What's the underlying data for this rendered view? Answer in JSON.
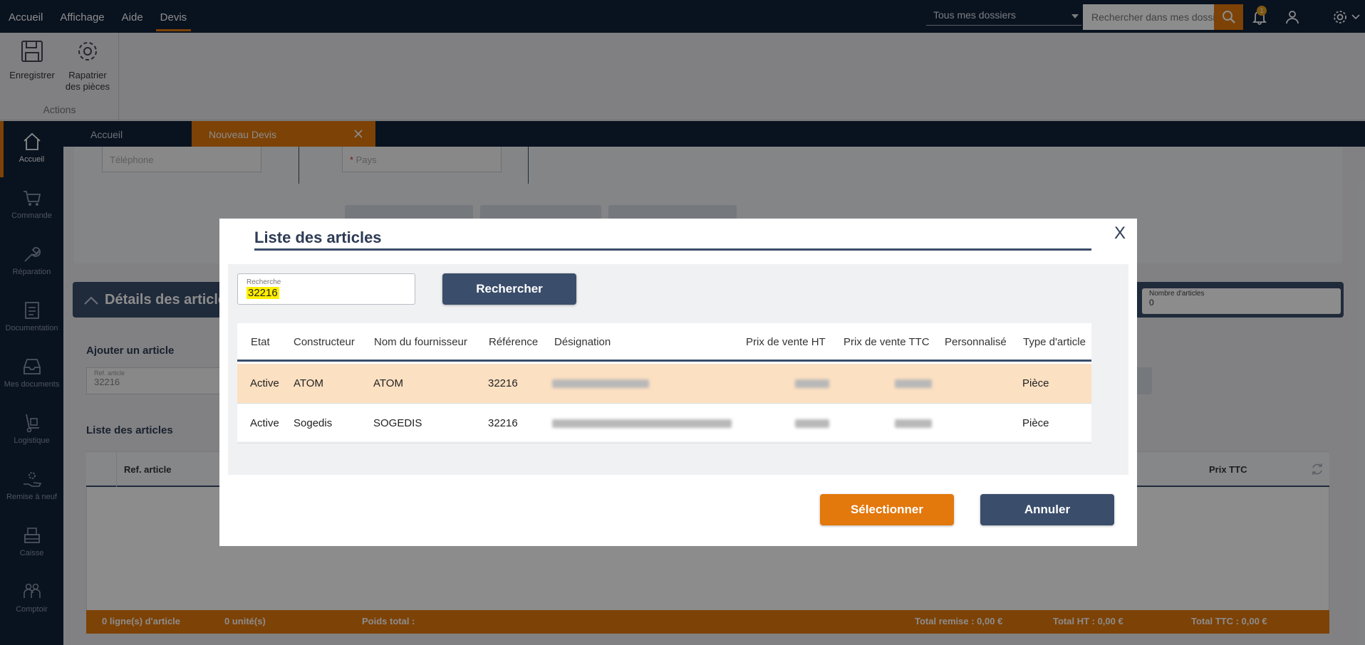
{
  "menu": {
    "items": [
      {
        "label": "Accueil"
      },
      {
        "label": "Affichage"
      },
      {
        "label": "Aide"
      },
      {
        "label": "Devis"
      }
    ]
  },
  "topbar": {
    "dossier_select": "Tous mes dossiers",
    "search_placeholder": "Rechercher dans mes dossiers",
    "notification_count": "1"
  },
  "ribbon": {
    "save_label": "Enregistrer",
    "import_label_line1": "Rapatrier",
    "import_label_line2": "des pièces",
    "group_label": "Actions"
  },
  "sidebar": {
    "items": [
      {
        "label": "Accueil",
        "icon": "home-icon"
      },
      {
        "label": "Commande",
        "icon": "cart-icon"
      },
      {
        "label": "Réparation",
        "icon": "wrench-icon"
      },
      {
        "label": "Documentation",
        "icon": "document-icon"
      },
      {
        "label": "Mes documents",
        "icon": "inbox-icon"
      },
      {
        "label": "Logistique",
        "icon": "hand-truck-icon"
      },
      {
        "label": "Remise à neuf",
        "icon": "refurbish-icon"
      },
      {
        "label": "Caisse",
        "icon": "register-icon"
      },
      {
        "label": "Comptoir",
        "icon": "people-icon"
      }
    ]
  },
  "tabs": [
    {
      "label": "Accueil"
    },
    {
      "label": "Nouveau Devis"
    }
  ],
  "background": {
    "phone_placeholder": "Téléphone",
    "country_placeholder": "Pays",
    "details_title": "Détails des articles",
    "nb_articles_label": "Nombre d'articles",
    "nb_articles_value": "0",
    "add_article_title": "Ajouter un article",
    "ref_label": "Ref. article",
    "ref_value": "32216",
    "list_title": "Liste des articles",
    "col_ref": "Ref. article",
    "col_prix_ttc": "Prix TTC",
    "footer": {
      "lines": "0 ligne(s) d'article",
      "units": "0 unité(s)",
      "weight": "Poids total :",
      "discount": "Total remise : 0,00 €",
      "total_ht": "Total HT : 0,00 €",
      "total_ttc": "Total TTC : 0,00 €"
    }
  },
  "modal": {
    "title": "Liste des articles",
    "close_label": "X",
    "search": {
      "label": "Recherche",
      "value": "32216"
    },
    "search_button": "Rechercher",
    "columns": [
      "Etat",
      "Constructeur",
      "Nom du fournisseur",
      "Référence",
      "Désignation",
      "Prix de vente HT",
      "Prix de vente TTC",
      "Personnalisé",
      "Type d'article"
    ],
    "rows": [
      {
        "etat": "Active",
        "constructeur": "ATOM",
        "fournisseur": "ATOM",
        "reference": "32216",
        "type": "Pièce",
        "selected": true
      },
      {
        "etat": "Active",
        "constructeur": "Sogedis",
        "fournisseur": "SOGEDIS",
        "reference": "32216",
        "type": "Pièce",
        "selected": false
      }
    ],
    "select_button": "Sélectionner",
    "cancel_button": "Annuler"
  },
  "colors": {
    "navy": "#12213a",
    "accent_orange": "#e3780c",
    "slate": "#3a4d6b",
    "selected_row": "#fce0c2",
    "highlight": "#ffef00"
  }
}
